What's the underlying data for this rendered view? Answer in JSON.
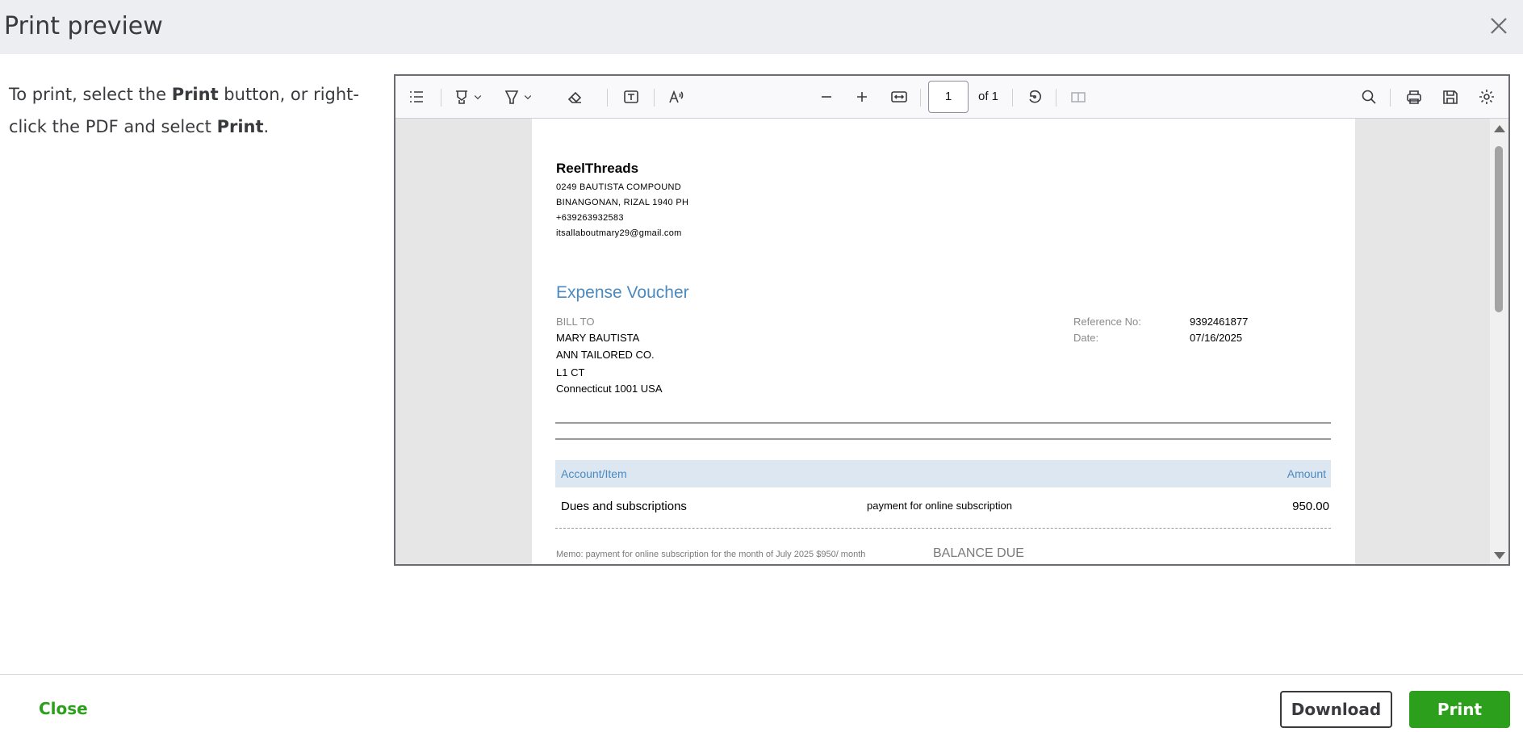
{
  "dialog": {
    "title": "Print preview",
    "instructions": {
      "part1": "To print, select the ",
      "bold1": "Print",
      "part2": " button, or right-click the PDF and select ",
      "bold2": "Print",
      "part3": "."
    }
  },
  "pdf_toolbar": {
    "page_number": "1",
    "page_of": "of 1",
    "icons": [
      "sidebar-toggle-icon",
      "highlight-icon",
      "chevron-down-icon",
      "draw-icon",
      "chevron-down-icon",
      "eraser-icon",
      "text-box-icon",
      "read-aloud-icon",
      "zoom-out-icon",
      "zoom-in-icon",
      "fit-width-icon",
      "rotate-icon",
      "two-page-icon",
      "search-icon",
      "print-icon",
      "save-icon",
      "settings-icon"
    ]
  },
  "document": {
    "company_name": "ReelThreads",
    "address_line1": "0249 BAUTISTA COMPOUND",
    "address_line2": "BINANGONAN, RIZAL  1940 PH",
    "phone": "+639263932583",
    "email": "itsallaboutmary29@gmail.com",
    "doc_title": "Expense Voucher",
    "bill_to_label": "BILL TO",
    "bill_to": [
      "MARY BAUTISTA",
      "ANN TAILORED CO.",
      "L1 CT",
      "Connecticut  1001 USA"
    ],
    "reference_label": "Reference No:",
    "reference_value": "9392461877",
    "date_label": "Date:",
    "date_value": "07/16/2025",
    "table": {
      "col_account": "Account/Item",
      "col_amount": "Amount",
      "rows": [
        {
          "account": "Dues and subscriptions",
          "description": "payment for online subscription",
          "amount": "950.00"
        }
      ]
    },
    "memo": "Memo: payment for online subscription for the month of July 2025 $950/ month",
    "balance_due_label": "BALANCE DUE"
  },
  "footer": {
    "close_label": "Close",
    "download_label": "Download",
    "print_label": "Print"
  },
  "colors": {
    "accent_green": "#2ca01c",
    "doc_blue": "#4a8ac0",
    "header_bg": "#eceef1"
  }
}
